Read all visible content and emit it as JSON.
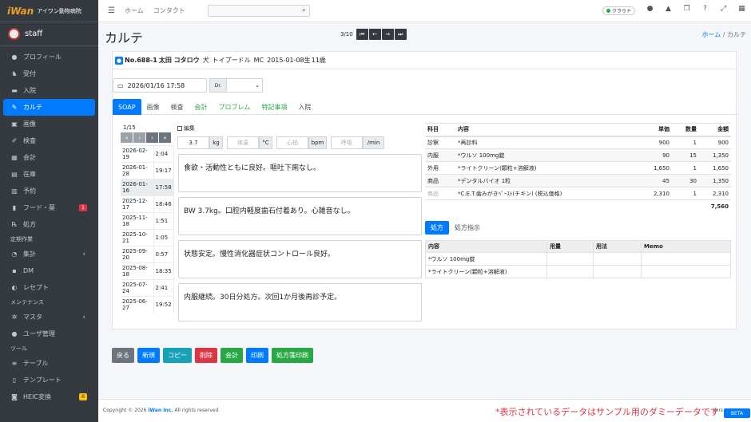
{
  "brand": {
    "logo": "iWan",
    "clinic": "アイワン動物病院"
  },
  "user": {
    "name": "staff"
  },
  "nav": {
    "items": [
      {
        "label": "プロフィール",
        "icon": "person-icon"
      },
      {
        "label": "受付",
        "icon": "dog-icon"
      },
      {
        "label": "入院",
        "icon": "bed-icon"
      },
      {
        "label": "カルテ",
        "icon": "edit-icon"
      },
      {
        "label": "画像",
        "icon": "image-icon"
      },
      {
        "label": "検査",
        "icon": "syringe-icon"
      },
      {
        "label": "会計",
        "icon": "calculator-icon"
      },
      {
        "label": "在庫",
        "icon": "box-icon"
      },
      {
        "label": "予約",
        "icon": "calendar-icon"
      },
      {
        "label": "フード・薬",
        "icon": "book-icon",
        "badge": "1"
      },
      {
        "label": "処方",
        "icon": "prescription-icon"
      }
    ],
    "section_regular": "定期作業",
    "regular": [
      {
        "label": "集計",
        "icon": "pie-chart-icon",
        "chevron": "‹"
      },
      {
        "label": "DM",
        "icon": "mail-icon"
      },
      {
        "label": "レセプト",
        "icon": "receipt-icon"
      }
    ],
    "section_maint": "メンテナンス",
    "maint": [
      {
        "label": "マスタ",
        "icon": "gear-icon",
        "chevron": "‹"
      },
      {
        "label": "ユーザ管理",
        "icon": "users-icon"
      }
    ],
    "section_tools": "ツール",
    "tools": [
      {
        "label": "テーブル",
        "icon": "list-icon"
      },
      {
        "label": "テンプレート",
        "icon": "file-icon"
      },
      {
        "label": "HEIC変換",
        "icon": "camera-icon",
        "badge": "6"
      }
    ]
  },
  "topbar": {
    "home": "ホーム",
    "contact": "コンタクト",
    "cloud": "クラウド"
  },
  "page": {
    "title": "カルテ",
    "pager_count": "3/10",
    "breadcrumb_home": "ホーム",
    "breadcrumb_sep": "/",
    "breadcrumb_current": "カルテ"
  },
  "patient": {
    "id": "No.688-1",
    "name": "太田 コタロウ",
    "species": "犬",
    "breed": "トイプードル",
    "sex": "MC",
    "birth": "2015-01-08生",
    "age": "11歳"
  },
  "visit": {
    "datetime": "2026/01/16 17:58",
    "dr_label": "Dr.",
    "dr_value": ""
  },
  "tabs": [
    "SOAP",
    "画像",
    "検査",
    "会計",
    "プロブレム",
    "特記事項",
    "入院"
  ],
  "history": {
    "page": "1/15",
    "rows": [
      {
        "date": "2026-02-19",
        "time": "2:04"
      },
      {
        "date": "2026-01-28",
        "time": "19:17"
      },
      {
        "date": "2026-01-16",
        "time": "17:58",
        "selected": true
      },
      {
        "date": "2025-12-17",
        "time": "18:46"
      },
      {
        "date": "2025-11-18",
        "time": "1:51"
      },
      {
        "date": "2025-10-21",
        "time": "1:05"
      },
      {
        "date": "2025-09-20",
        "time": "0:57"
      },
      {
        "date": "2025-08-18",
        "time": "18:35"
      },
      {
        "date": "2025-07-24",
        "time": "2:41"
      },
      {
        "date": "2025-06-27",
        "time": "19:52"
      }
    ]
  },
  "soap": {
    "edit_label": "編集",
    "weight": "3.7",
    "weight_unit": "kg",
    "temp_ph": "体温",
    "temp_unit": "°C",
    "hr_ph": "心拍",
    "hr_unit": "bpm",
    "rr_ph": "呼吸",
    "rr_unit": "/min",
    "notes": [
      "食欲・活動性ともに良好。嘔吐下痢なし。",
      "BW 3.7kg。口腔内軽度歯石付着あり。心雑音なし。",
      "状態安定。慢性消化器症状コントロール良好。",
      "内服継続。30日分処方。次回1か月後再診予定。"
    ]
  },
  "fees": {
    "headers": [
      "科目",
      "内容",
      "単価",
      "数量",
      "金額"
    ],
    "rows": [
      {
        "cat": "診察",
        "item": "*再診料",
        "price": "900",
        "qty": "1",
        "amount": "900"
      },
      {
        "cat": "内服",
        "item": "*ウルソ 100mg錠",
        "price": "90",
        "qty": "15",
        "amount": "1,350"
      },
      {
        "cat": "外用",
        "item": "*ライトクリーン(顆粒+溶解液)",
        "price": "1,650",
        "qty": "1",
        "amount": "1,650"
      },
      {
        "cat": "商品",
        "item": "*デンタルバイオ 1粒",
        "price": "45",
        "qty": "30",
        "amount": "1,350"
      },
      {
        "cat": "商品",
        "item": "*C.E.T.歯みがきﾍﾟｰｽﾄ(チキン) (税込価格)",
        "price": "2,310",
        "qty": "1",
        "amount": "2,310",
        "faded": true
      }
    ],
    "total": "7,560"
  },
  "rx": {
    "tabs": [
      "処方",
      "処方指示"
    ],
    "headers": [
      "内容",
      "用量",
      "用法",
      "Memo"
    ],
    "rows": [
      {
        "item": "*ウルソ 100mg錠"
      },
      {
        "item": "*ライトクリーン(顆粒+溶解液)"
      }
    ]
  },
  "actions": [
    "戻る",
    "新規",
    "コピー",
    "削除",
    "会計",
    "印刷",
    "処方箋印刷"
  ],
  "footer": {
    "copyright_pre": "Copyright © 2026",
    "brand": "iWan Inc.",
    "copyright_post": "All rights reserved.",
    "notice": "*表示されているデータはサンプル用のダミーデータです",
    "version": "Vers",
    "beta": "BETA"
  },
  "colors": {
    "primary": "#007bff",
    "sidebar": "#343a40",
    "danger": "#dc3545",
    "success": "#28a745",
    "info": "#17a2b8"
  }
}
